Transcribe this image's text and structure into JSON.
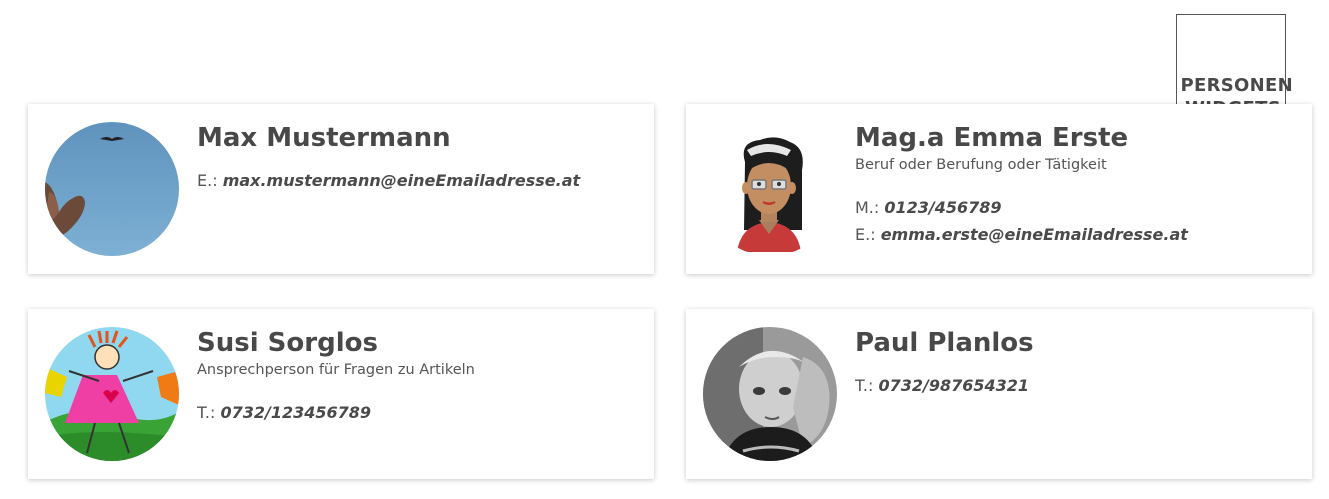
{
  "logo": {
    "line1": "PERSONEN",
    "line2": "WIDGETS"
  },
  "persons": [
    {
      "name": "Max Mustermann",
      "role": "",
      "contacts": [
        {
          "prefix": "E.:",
          "value": "max.mustermann@eineEmailadresse.at"
        }
      ]
    },
    {
      "name": "Mag.a Emma Erste",
      "role": "Beruf oder Berufung oder Tätigkeit",
      "contacts": [
        {
          "prefix": "M.:",
          "value": "0123/456789"
        },
        {
          "prefix": "E.:",
          "value": "emma.erste@eineEmailadresse.at"
        }
      ]
    },
    {
      "name": "Susi Sorglos",
      "role": "Ansprechperson für Fragen zu Artikeln",
      "contacts": [
        {
          "prefix": "T.:",
          "value": "0732/123456789"
        }
      ]
    },
    {
      "name": "Paul Planlos",
      "role": "",
      "contacts": [
        {
          "prefix": "T.:",
          "value": "0732/987654321"
        }
      ]
    }
  ]
}
